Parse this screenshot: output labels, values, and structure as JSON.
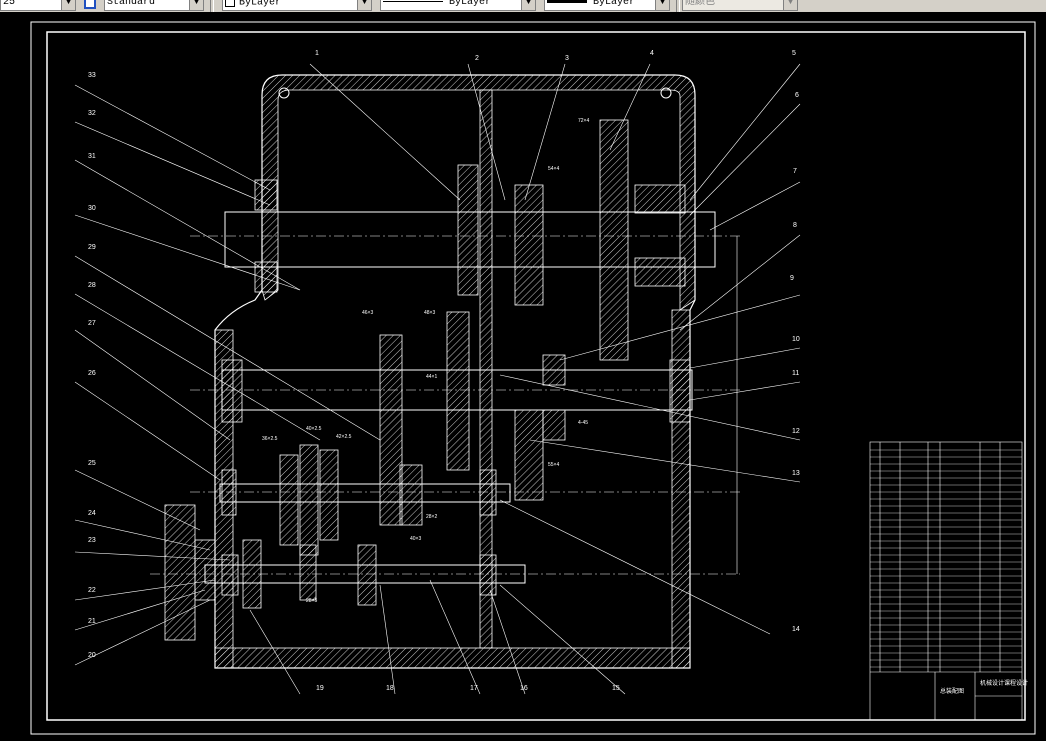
{
  "toolbar": {
    "scale_value": "25",
    "text_style": "Standard",
    "layer": "ByLayer",
    "linetype": "ByLayer",
    "lineweight": "ByLayer",
    "color": "随颜色"
  },
  "drawing": {
    "callouts": [
      "1",
      "2",
      "3",
      "4",
      "5",
      "6",
      "7",
      "8",
      "9",
      "10",
      "11",
      "12",
      "13",
      "14",
      "15",
      "16",
      "17",
      "18",
      "19",
      "20",
      "21",
      "22",
      "23",
      "24",
      "25",
      "26",
      "27",
      "28",
      "29",
      "30",
      "31",
      "32",
      "33"
    ],
    "dim_labels": [
      "72×4",
      "54×4",
      "46×3",
      "48×3",
      "44×1",
      "28×2",
      "4-45",
      "55×4",
      "36×2.5",
      "40×2.5",
      "42×2.5",
      "28×5",
      "40×3"
    ]
  },
  "title_block": {
    "drawing_name": "总装配图",
    "school": "机械设计课程设计"
  }
}
